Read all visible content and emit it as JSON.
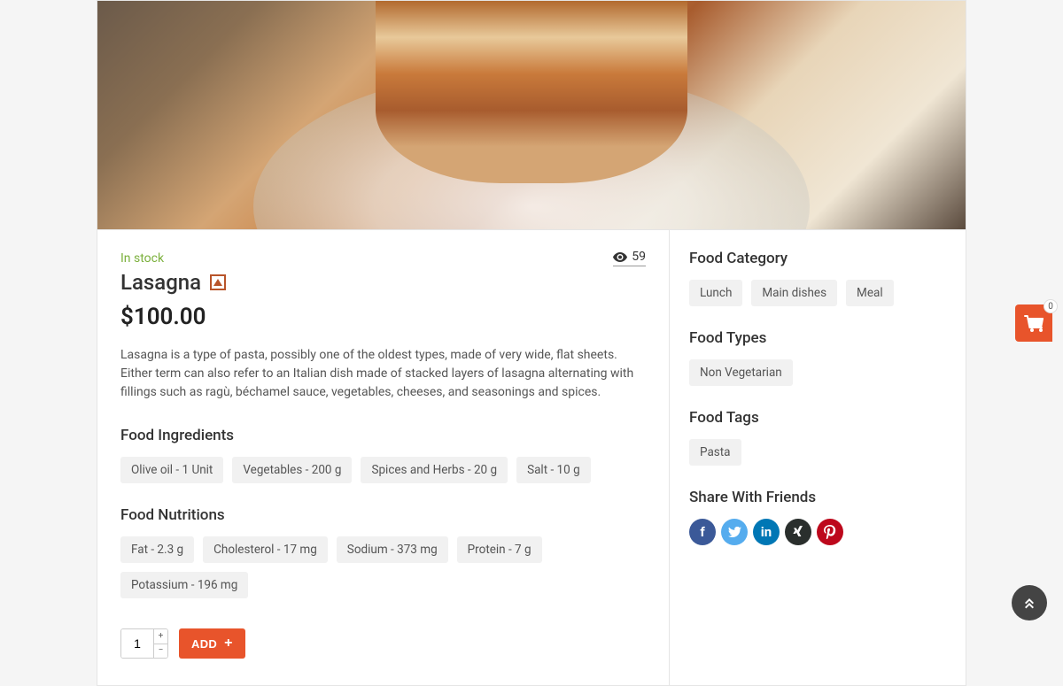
{
  "stock_label": "In stock",
  "view_count": "59",
  "product_title": "Lasagna",
  "price": "$100.00",
  "description": "Lasagna is a type of pasta, possibly one of the oldest types, made of very wide, flat sheets. Either term can also refer to an Italian dish made of stacked layers of lasagna alternating with fillings such as ragù, béchamel sauce, vegetables, cheeses, and seasonings and spices.",
  "ingredients": {
    "heading": "Food Ingredients",
    "items": [
      "Olive oil - 1 Unit",
      "Vegetables - 200 g",
      "Spices and Herbs - 20 g",
      "Salt - 10 g"
    ]
  },
  "nutritions": {
    "heading": "Food Nutritions",
    "items": [
      "Fat - 2.3 g",
      "Cholesterol - 17 mg",
      "Sodium - 373 mg",
      "Protein - 7 g",
      "Potassium - 196 mg"
    ]
  },
  "qty_value": "1",
  "add_label": "ADD",
  "sidebar": {
    "category": {
      "heading": "Food Category",
      "items": [
        "Lunch",
        "Main dishes",
        "Meal"
      ]
    },
    "types": {
      "heading": "Food Types",
      "items": [
        "Non Vegetarian"
      ]
    },
    "tags": {
      "heading": "Food Tags",
      "items": [
        "Pasta"
      ]
    },
    "share_heading": "Share With Friends"
  },
  "cart_count": "0"
}
